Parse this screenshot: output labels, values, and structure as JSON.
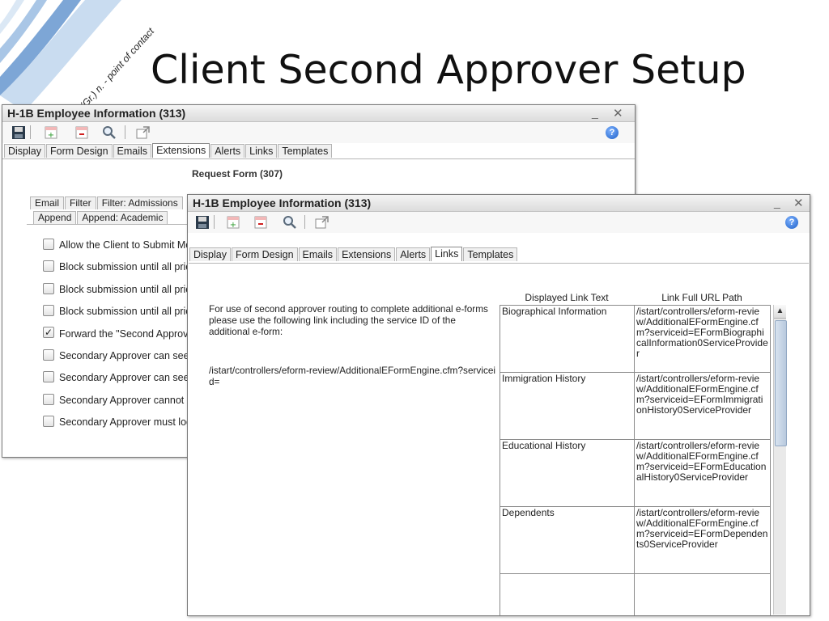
{
  "slide": {
    "title": "Client Second Approver Setup",
    "tagline": "(Gr.) n. - point of contact"
  },
  "colors": {
    "swoosh": "#7da6d6",
    "active_tab_border": "#8a8a8a",
    "help_icon": "#1d5fc7"
  },
  "icons": {
    "save": "floppy-disk-icon",
    "add": "add-row-icon",
    "remove": "remove-row-icon",
    "search": "magnifier-icon",
    "popout": "popout-icon",
    "help": "help-icon"
  },
  "back_window": {
    "title": "H-1B Employee Information (313)",
    "behind_title": "Request Form (307)",
    "tabs": [
      "Display",
      "Form Design",
      "Emails",
      "Extensions",
      "Alerts",
      "Links",
      "Templates"
    ],
    "active_tab": "Extensions",
    "subtabs_row1": [
      "Email",
      "Filter",
      "Filter: Admissions"
    ],
    "subtabs_row2": [
      "Append",
      "Append: Academic"
    ],
    "checkboxes": [
      {
        "label": "Allow the Client to Submit Mo",
        "checked": false
      },
      {
        "label": "Block submission until all pric",
        "checked": false
      },
      {
        "label": "Block submission until all pric",
        "checked": false
      },
      {
        "label": "Block submission until all pric",
        "checked": false
      },
      {
        "label": "Forward the \"Second Approv",
        "checked": true
      },
      {
        "label": "Secondary Approver can see",
        "checked": false
      },
      {
        "label": "Secondary Approver can see",
        "checked": false
      },
      {
        "label": "Secondary Approver cannot s",
        "checked": false
      },
      {
        "label": "Secondary Approver must log",
        "checked": false
      }
    ]
  },
  "front_window": {
    "title": "H-1B Employee Information (313)",
    "tabs": [
      "Display",
      "Form Design",
      "Emails",
      "Extensions",
      "Alerts",
      "Links",
      "Templates"
    ],
    "active_tab": "Links",
    "info_text": "For use of second approver routing to complete additional e-forms please use the following link including the service ID of the additional e-form:",
    "info_path": "/istart/controllers/eform-review/AdditionalEFormEngine.cfm?serviceid=",
    "column_headers": {
      "display_text": "Displayed Link Text",
      "url": "Link Full URL Path"
    },
    "rows": [
      {
        "text": "Biographical Information",
        "url": "/istart/controllers/eform-review/AdditionalEFormEngine.cfm?serviceid=EFormBiographicalInformation0ServiceProvider"
      },
      {
        "text": "Immigration History",
        "url": "/istart/controllers/eform-review/AdditionalEFormEngine.cfm?serviceid=EFormImmigrationHistory0ServiceProvider"
      },
      {
        "text": "Educational History",
        "url": "/istart/controllers/eform-review/AdditionalEFormEngine.cfm?serviceid=EFormEducationalHistory0ServiceProvider"
      },
      {
        "text": "Dependents",
        "url": "/istart/controllers/eform-review/AdditionalEFormEngine.cfm?serviceid=EFormDependents0ServiceProvider"
      },
      {
        "text": "",
        "url": ""
      }
    ]
  }
}
